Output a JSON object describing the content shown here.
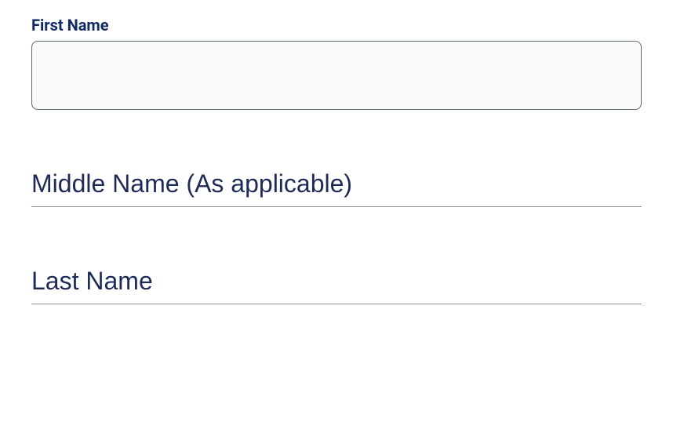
{
  "form": {
    "first_name": {
      "label": "First Name",
      "value": ""
    },
    "middle_name": {
      "placeholder": "Middle Name (As applicable)",
      "value": ""
    },
    "last_name": {
      "placeholder": "Last Name",
      "value": ""
    }
  }
}
